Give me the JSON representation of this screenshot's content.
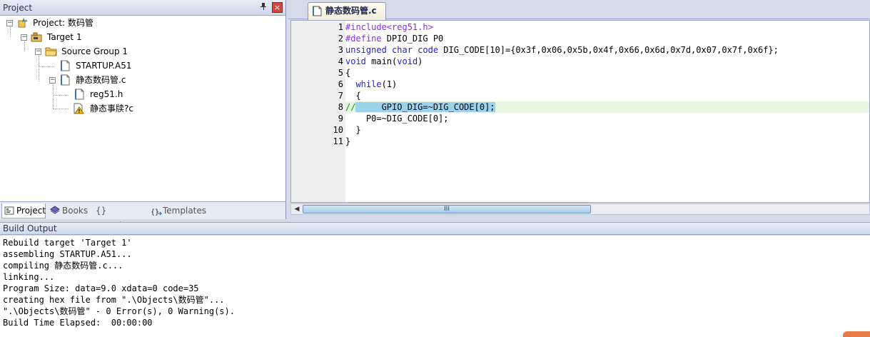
{
  "project_panel": {
    "title": "Project",
    "pin_glyph": "ᵱ",
    "close_glyph": "×",
    "tree": {
      "project": "Project: 数码管",
      "target": "Target 1",
      "group": "Source Group 1",
      "file_startup": "STARTUP.A51",
      "file_c": "静态数码管.c",
      "file_reg": "reg51.h",
      "file_warn": "静态事牍?c"
    },
    "tabs": {
      "project": "Project",
      "books": "Books",
      "functions": "{} Functions",
      "templates": "Templates"
    }
  },
  "editor": {
    "tab_label": "静态数码管.c",
    "line_numbers": [
      "1",
      "2",
      "3",
      "4",
      "5",
      "6",
      "7",
      "8",
      "9",
      "10",
      "11"
    ],
    "code": {
      "l1": "#include<reg51.h>",
      "l2_kw": "#define",
      "l2_rest": " DPIO_DIG P0",
      "l3_kw": "unsigned char code",
      "l3_rest": " DIG_CODE[10]={0x3f,0x06,0x5b,0x4f,0x66,0x6d,0x7d,0x07,0x7f,0x6f};",
      "l4_kw": "void",
      "l4_mid": " main(",
      "l4_kw2": "void",
      "l4_end": ")",
      "l5": "{",
      "l6_kw": "  while",
      "l6_rest": "(1)",
      "l7": "  {",
      "l8_comment": "//",
      "l8_sel": "     GPIO_DIG=~DIG_CODE[0];",
      "l9": "    P0=~DIG_CODE[0];",
      "l10": "  }",
      "l11": "}"
    },
    "scroll_grip": "III"
  },
  "build": {
    "title": "Build Output",
    "lines": [
      "Rebuild target 'Target 1'",
      "assembling STARTUP.A51...",
      "compiling 静态数码管.c...",
      "linking...",
      "Program Size: data=9.0 xdata=0 code=35",
      "creating hex file from \".\\Objects\\数码管\"...",
      "\".\\Objects\\数码管\" - 0 Error(s), 0 Warning(s).",
      "Build Time Elapsed:  00:00:00"
    ]
  },
  "colors": {
    "highlight_line": "#e5f7e0",
    "selection": "#9cd2ec",
    "keyword": "#2222cc",
    "preprocessor": "#8a2be2",
    "comment": "#228b22"
  }
}
